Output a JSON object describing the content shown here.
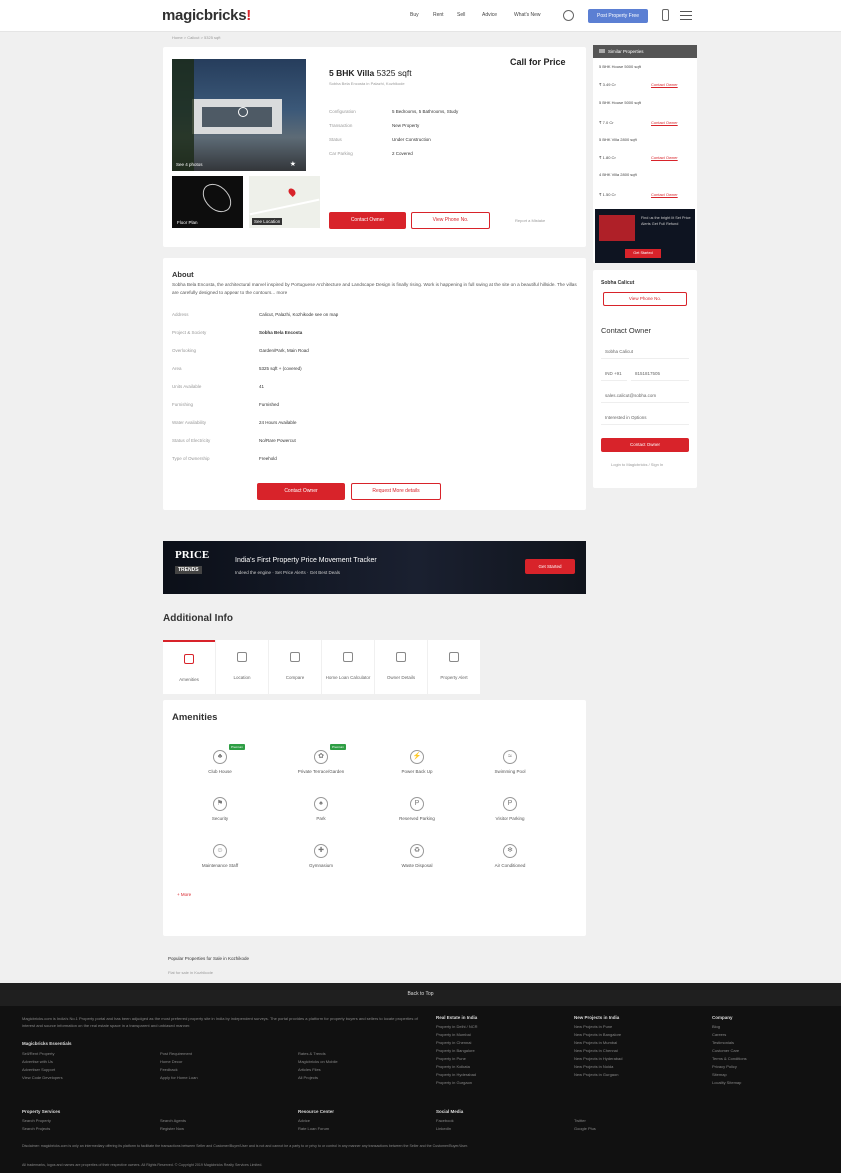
{
  "header": {
    "logo_text": "magicbricks",
    "logo_mark": "!",
    "nav": [
      "Buy",
      "Rent",
      "Sell",
      "Advice",
      "What's New"
    ],
    "post_btn": "Post Property Free"
  },
  "breadcrumb": "Home > Calicut > 5325 sqft",
  "listing": {
    "title_bold": "5 BHK Villa",
    "title_area": "5325 sqft",
    "subtitle": "Sobha Bela Encosta in Palazhi, Kozhikode",
    "price": "Call for Price",
    "photo_count": "See 4 photos",
    "floor_plan": "Floor Plan",
    "see_location": "See Location",
    "details": [
      {
        "k": "Configuration",
        "v": "5 Bedrooms, 5 Bathrooms, Study"
      },
      {
        "k": "Transaction",
        "v": "New Property"
      },
      {
        "k": "Status",
        "v": "Under Construction"
      },
      {
        "k": "Car Parking",
        "v": "2 Covered"
      }
    ],
    "contact_owner": "Contact Owner",
    "view_phone": "View Phone No.",
    "report": "Report a Mistake"
  },
  "about": {
    "heading": "About",
    "text": "Sobha Bela Encosta, the architectural marvel inspired by Portuguese Architecture and Landscape Design is finally rising. Work is happening in full swing at the site on a beautiful hillside. The villas are carefully designed to appear to the contours... more",
    "rows": [
      {
        "k": "Address",
        "v": "Calicut, Palazhi, Kozhikode see on map"
      },
      {
        "k": "Project & Society",
        "v": "Sobha Bela Encosta"
      },
      {
        "k": "Overlooking",
        "v": "Garden/Park, Main Road"
      },
      {
        "k": "Area",
        "v": "5325 sqft  + (covered)"
      },
      {
        "k": "Units Available",
        "v": "41"
      },
      {
        "k": "Furnishing",
        "v": "Furnished"
      },
      {
        "k": "Water Availability",
        "v": "24 Hours Available"
      },
      {
        "k": "Status of Electricity",
        "v": "No/Rare Powercut"
      },
      {
        "k": "Type of Ownership",
        "v": "Freehold"
      }
    ],
    "contact_owner": "Contact Owner",
    "request_more": "Request More details"
  },
  "sidebar": {
    "heading": "Similar Properties",
    "items": [
      {
        "t": "5 BHK House 5000 sqft",
        "p": "₹ 3.49 Cr",
        "c": "Contact Owner"
      },
      {
        "t": "5 BHK House 5000 sqft",
        "p": "₹ 7.0 Cr",
        "c": "Contact Owner"
      },
      {
        "t": "5 BHK Villa 2800 sqft",
        "p": "₹ 1.80 Cr",
        "c": "Contact Owner"
      },
      {
        "t": "4 BHK Villa 2800 sqft",
        "p": "₹ 1.50 Cr",
        "c": "Contact Owner"
      }
    ],
    "ad_text": "Find us the bright lit Set Price Alerts Get Full Refund",
    "ad_btn": "Get Started",
    "builder": "Sobha Calicut",
    "builder_btn": "View Phone No.",
    "contact_heading": "Contact Owner",
    "name_val": "Sobha Calicut",
    "cc": "IND +91",
    "phone": "8151817505",
    "email": "sales.calicut@sobha.com",
    "interest": "Interested in Options",
    "send": "Contact Owner",
    "login": "Login to Magicbricks / Sign In"
  },
  "banner": {
    "brand": "PRICE",
    "brand2": "TRENDS",
    "title": "India's First Property Price Movement Tracker",
    "sub": "Indeed the engine · Set Price Alerts · Get Best Deals",
    "btn": "Get Started"
  },
  "additional": {
    "heading": "Additional Info",
    "tabs": [
      "Amenities",
      "Location",
      "Compare",
      "Home Loan Calculator",
      "Owner Details",
      "Property Alert"
    ]
  },
  "amenities": {
    "heading": "Amenities",
    "badge": "Premium",
    "more": "+ More",
    "items": [
      {
        "n": "Club House",
        "s": "♣"
      },
      {
        "n": "Private Terrace/Garden",
        "s": "✿"
      },
      {
        "n": "Power Back Up",
        "s": "⚡"
      },
      {
        "n": "Swimming Pool",
        "s": "≈"
      },
      {
        "n": "Security",
        "s": "⚑"
      },
      {
        "n": "Park",
        "s": "♠"
      },
      {
        "n": "Reserved Parking",
        "s": "P"
      },
      {
        "n": "Visitor Parking",
        "s": "P"
      },
      {
        "n": "Maintenance Staff",
        "s": "☺"
      },
      {
        "n": "Gymnasium",
        "s": "✚"
      },
      {
        "n": "Waste Disposal",
        "s": "♻"
      },
      {
        "n": "Air Conditioned",
        "s": "❄"
      }
    ]
  },
  "popular": "Popular Properties for Sale in Kozhikode",
  "popular_sub": "Flat for sale in Kozhikode",
  "footer": {
    "back_to_top": "Back to Top",
    "about": "Magicbricks.com is India's No.1 Property portal and has been adjudged as the most preferred property site in India by independent surveys. The portal provides a platform for property buyers and sellers to locate properties of interest and source information on the real estate space in a transparent and unbiased manner.",
    "essentials_h": "Magicbricks Essentials",
    "essentials": [
      "Sell/Rent Property",
      "Advertise with Us",
      "Advertiser Support",
      "View Code Developers",
      "Post Requirement",
      "Home Decor",
      "Feedback",
      "Apply for Home Loan",
      "Rates & Trends",
      "Magicbricks on Mobile",
      "Articles Files",
      "All Projects"
    ],
    "real_estate_h": "Real Estate in India",
    "real_estate": [
      "Property in Delhi / NCR",
      "Property in Mumbai",
      "Property in Chennai",
      "Property in Bangalore",
      "Property in Pune",
      "Property in Kolkata",
      "Property in Hyderabad",
      "Property in Gurgaon"
    ],
    "new_proj_h": "New Projects in India",
    "new_proj": [
      "New Projects in Pune",
      "New Projects in Bangalore",
      "New Projects in Mumbai",
      "New Projects in Chennai",
      "New Projects in Hyderabad",
      "New Projects in Noida",
      "New Projects in Gurgaon"
    ],
    "company_h": "Company",
    "company": [
      "Blog",
      "Careers",
      "Testimonials",
      "Customer Care",
      "Terms & Conditions",
      "Privacy Policy",
      "Sitemap",
      "Locality Sitemap"
    ],
    "services_h": "Property Services",
    "services": [
      "Search Property",
      "Search Projects",
      "Search Agents",
      "Register Now"
    ],
    "resource_h": "Resource Center",
    "resource": [
      "Advice",
      "Rate Loan Forum"
    ],
    "social_h": "Social Media",
    "social": [
      "Facebook",
      "LinkedIn",
      "Twitter",
      "Google Plus"
    ],
    "disclaimer": "Disclaimer: magicbricks.com is only an intermediary offering its platform to facilitate the transactions between Seller and Customer/Buyer/User and is not and cannot be a party to or privy to or control in any manner any transactions between the Seller and the Customer/Buyer/User.",
    "copyright": "All trademarks, logos and names are properties of their respective owners. All Rights Reserved. © Copyright 2019 Magicbricks Realty Services Limited."
  }
}
